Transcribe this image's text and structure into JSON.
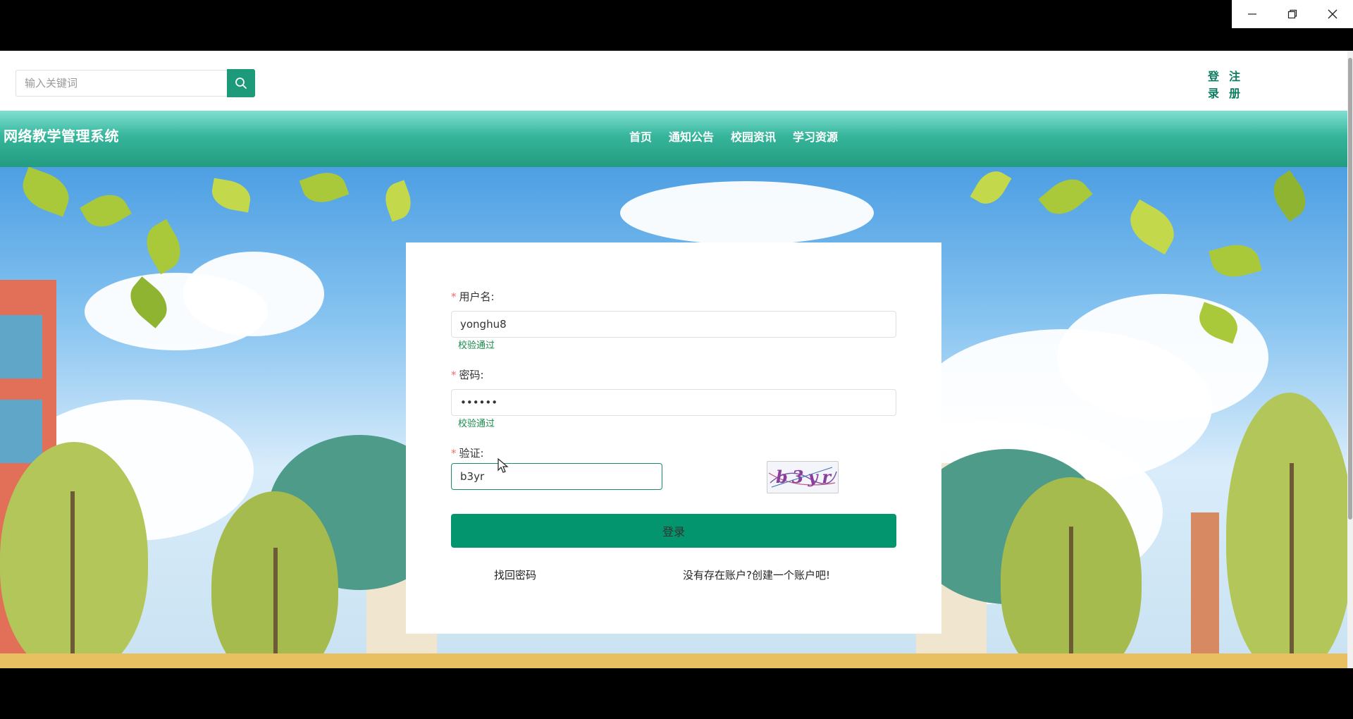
{
  "window": {
    "minimize_icon": "minimize-icon",
    "maximize_icon": "restore-icon",
    "close_icon": "close-icon"
  },
  "header": {
    "search_placeholder": "输入关键词",
    "search_icon": "search-icon",
    "login_label": "登录",
    "register_label": "注册"
  },
  "nav": {
    "site_title": "网络教学管理系统",
    "items": [
      "首页",
      "通知公告",
      "校园资讯",
      "学习资源"
    ]
  },
  "login_form": {
    "username_label": "用户名:",
    "username_value": "yonghu8",
    "username_status": "校验通过",
    "password_label": "密码:",
    "password_value": "••••••",
    "password_status": "校验通过",
    "captcha_label": "验证:",
    "captcha_value": "b3yr",
    "captcha_image_text": "b3yr",
    "required_mark": "*",
    "submit_label": "登录",
    "forgot_label": "找回密码",
    "register_prompt": "没有存在账户?创建一个账户吧!"
  },
  "colors": {
    "brand": "#1c9a79",
    "nav_gradient_top": "#7fe0d2",
    "nav_gradient_bottom": "#239c80",
    "submit_button": "#03966e",
    "valid_text": "#1c8a4c",
    "required": "#f56c6c"
  }
}
